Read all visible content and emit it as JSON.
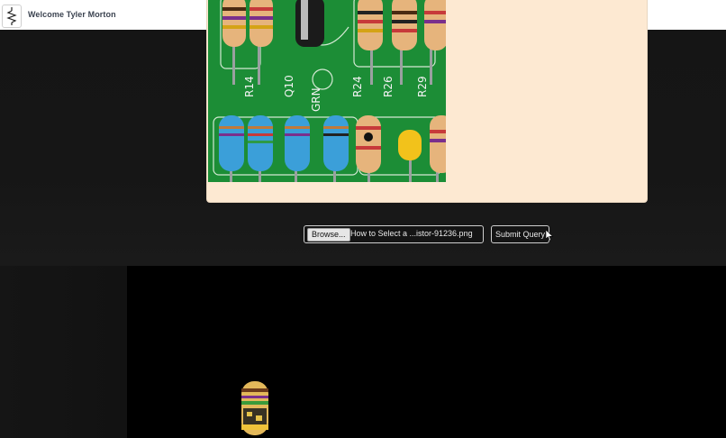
{
  "header": {
    "welcome_text": "Welcome Tyler Morton"
  },
  "image_card": {
    "board_labels": [
      "R14",
      "Q10",
      "GRN",
      "R24",
      "R26",
      "R29"
    ]
  },
  "upload": {
    "browse_label": "Browse...",
    "file_name": "How to Select a ...istor-91236.png",
    "submit_label": "Submit Query"
  },
  "icons": {
    "logo": "resistor-logo-icon",
    "cursor": "mouse-pointer-icon"
  },
  "colors": {
    "background": "#111111",
    "header": "#ffffff",
    "card": "#fde9d2",
    "pcb_green": "#1c8d36",
    "result_area": "#000000"
  }
}
